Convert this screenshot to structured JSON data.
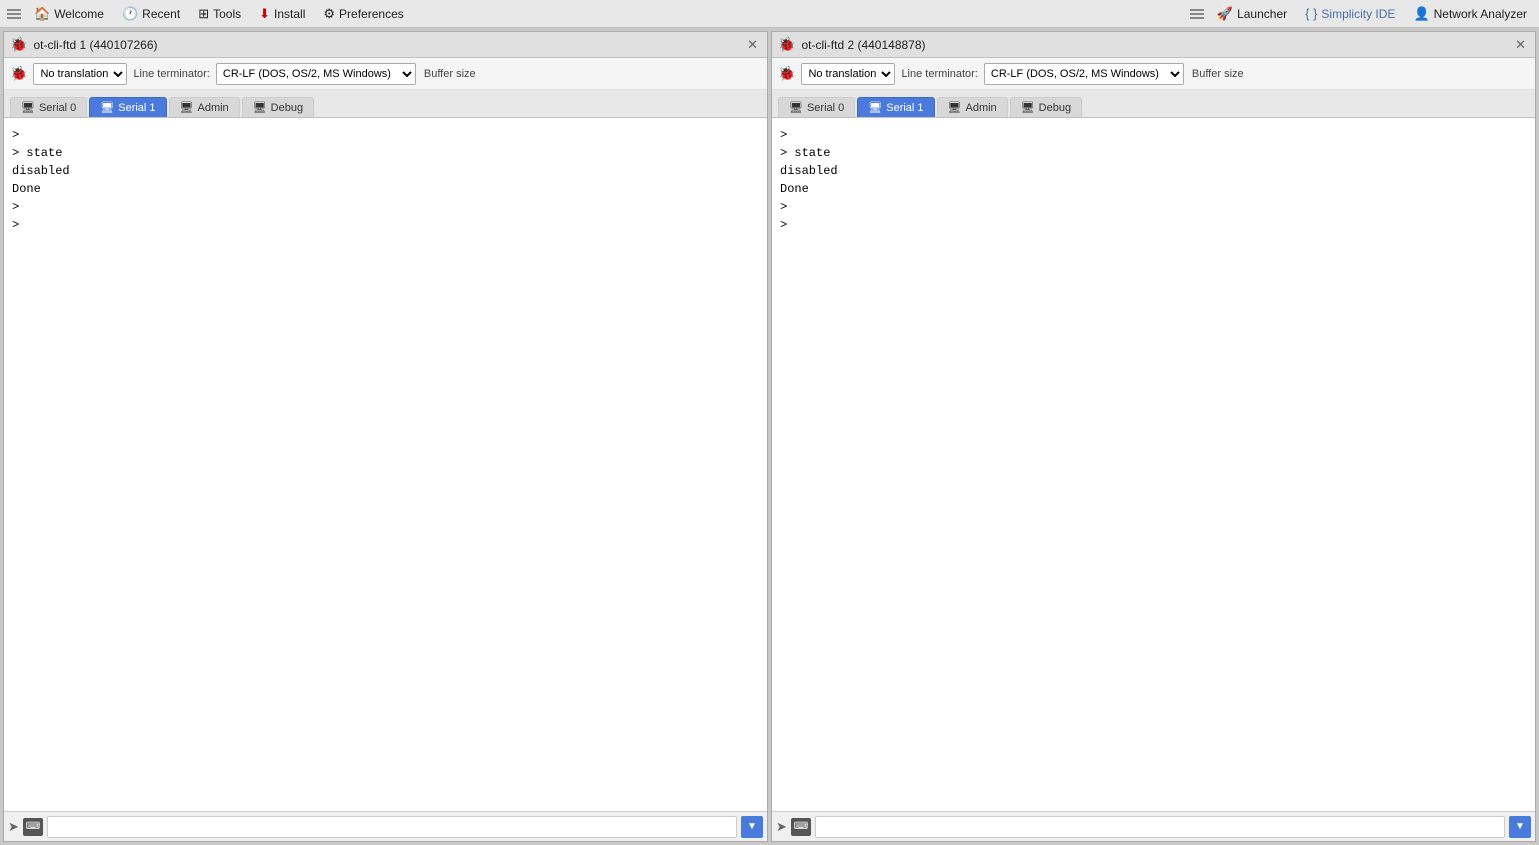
{
  "menubar": {
    "items": [
      {
        "id": "welcome",
        "label": "Welcome",
        "icon": "🏠"
      },
      {
        "id": "recent",
        "label": "Recent",
        "icon": "🕐"
      },
      {
        "id": "tools",
        "label": "Tools",
        "icon": "⊞"
      },
      {
        "id": "install",
        "label": "Install",
        "icon": "⬇"
      },
      {
        "id": "preferences",
        "label": "Preferences",
        "icon": "⚙"
      }
    ],
    "right_items": [
      {
        "id": "launcher",
        "label": "Launcher",
        "icon": "🚀"
      },
      {
        "id": "simplicity-ide",
        "label": "Simplicity IDE",
        "icon": "{ }"
      },
      {
        "id": "network-analyzer",
        "label": "Network Analyzer",
        "icon": "👤"
      }
    ]
  },
  "panels": [
    {
      "id": "panel-1",
      "title": "ot-cli-ftd 1 (440107266)",
      "close_label": "✕",
      "toolbar": {
        "translation_label": "No translation",
        "line_terminator_label": "Line terminator:",
        "line_terminator_value": "CR-LF  (DOS, OS/2, MS Windows)",
        "buffer_label": "Buffer size"
      },
      "tabs": [
        {
          "id": "serial0",
          "label": "Serial 0",
          "icon": "🖥",
          "active": false
        },
        {
          "id": "serial1",
          "label": "Serial 1",
          "icon": "🖥",
          "active": true
        },
        {
          "id": "admin",
          "label": "Admin",
          "icon": "🖥",
          "active": false
        },
        {
          "id": "debug",
          "label": "Debug",
          "icon": "🖥",
          "active": false
        }
      ],
      "terminal_lines": [
        ">",
        "> state",
        "disabled",
        "Done",
        ">",
        ">"
      ]
    },
    {
      "id": "panel-2",
      "title": "ot-cli-ftd 2 (440148878)",
      "close_label": "✕",
      "toolbar": {
        "translation_label": "No translation",
        "line_terminator_label": "Line terminator:",
        "line_terminator_value": "CR-LF  (DOS, OS/2, MS Windows)",
        "buffer_label": "Buffer size"
      },
      "tabs": [
        {
          "id": "serial0",
          "label": "Serial 0",
          "icon": "🖥",
          "active": false
        },
        {
          "id": "serial1",
          "label": "Serial 1",
          "icon": "🖥",
          "active": true
        },
        {
          "id": "admin",
          "label": "Admin",
          "icon": "🖥",
          "active": false
        },
        {
          "id": "debug",
          "label": "Debug",
          "icon": "🖥",
          "active": false
        }
      ],
      "terminal_lines": [
        ">",
        "> state",
        "disabled",
        "Done",
        ">",
        ">"
      ]
    }
  ]
}
